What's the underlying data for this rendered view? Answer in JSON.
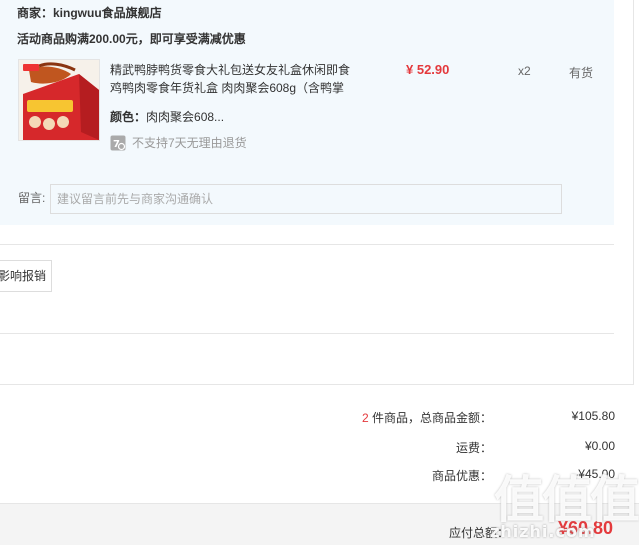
{
  "shop": {
    "merchant": "商家：kingwuu食品旗舰店",
    "promo": "活动商品购满200.00元，即可享受满减优惠"
  },
  "product": {
    "title": "精武鸭脖鸭货零食大礼包送女友礼盒休闲即食鸡鸭肉零食年货礼盒 肉肉聚会608g（含鸭掌",
    "attr_label": "颜色：",
    "attr_value": "肉肉聚会608...",
    "return_note": "不支持7天无理由退货",
    "price": "¥ 52.90",
    "qty": "x2",
    "stock": "有货"
  },
  "message": {
    "label": "留言:",
    "placeholder": "建议留言前先与商家沟通确认"
  },
  "invoice": {
    "button_label": "影响报销"
  },
  "summary": {
    "count": "2",
    "count_suffix": " 件商品，总商品金额：",
    "goods_total": "¥105.80",
    "shipping_label": "运费：",
    "shipping": "¥0.00",
    "discount_label": "商品优惠：",
    "discount": "-¥45.00",
    "payable_label": "应付总额：",
    "payable": "¥60.80"
  },
  "watermark": {
    "glyphs": "值值值",
    "domain": "zhizhi.com"
  },
  "colors": {
    "price_red": "#e4393c",
    "panel_bg": "#f3f9fd"
  }
}
